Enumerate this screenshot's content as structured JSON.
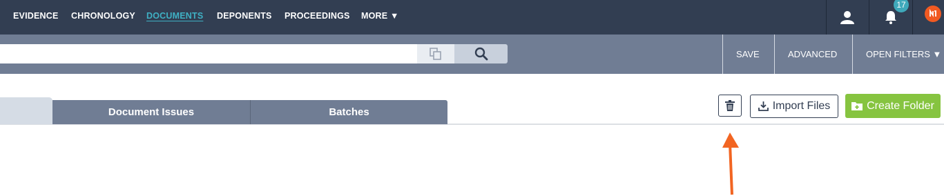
{
  "nav": {
    "items": [
      {
        "label": "EVIDENCE"
      },
      {
        "label": "CHRONOLOGY"
      },
      {
        "label": "DOCUMENTS",
        "active": true
      },
      {
        "label": "DEPONENTS"
      },
      {
        "label": "PROCEEDINGS"
      },
      {
        "label": "MORE ▼"
      }
    ],
    "notification_count": "17",
    "icons": [
      "user-icon",
      "bell-icon",
      "brand-logo-icon"
    ]
  },
  "search": {
    "value": "",
    "placeholder": "",
    "links": {
      "save": "SAVE",
      "advanced": "ADVANCED",
      "open_filters": "OPEN FILTERS ▼"
    }
  },
  "tabs": [
    {
      "label": "",
      "active": true
    },
    {
      "label": "Document Issues"
    },
    {
      "label": "Batches"
    }
  ],
  "actions": {
    "import_label": "Import Files",
    "create_label": "Create Folder"
  },
  "colors": {
    "nav_bg": "#323e52",
    "active_link": "#3fb0c4",
    "search_bar_bg": "#707d94",
    "create_button": "#86c440",
    "annotation_arrow": "#f26522"
  }
}
